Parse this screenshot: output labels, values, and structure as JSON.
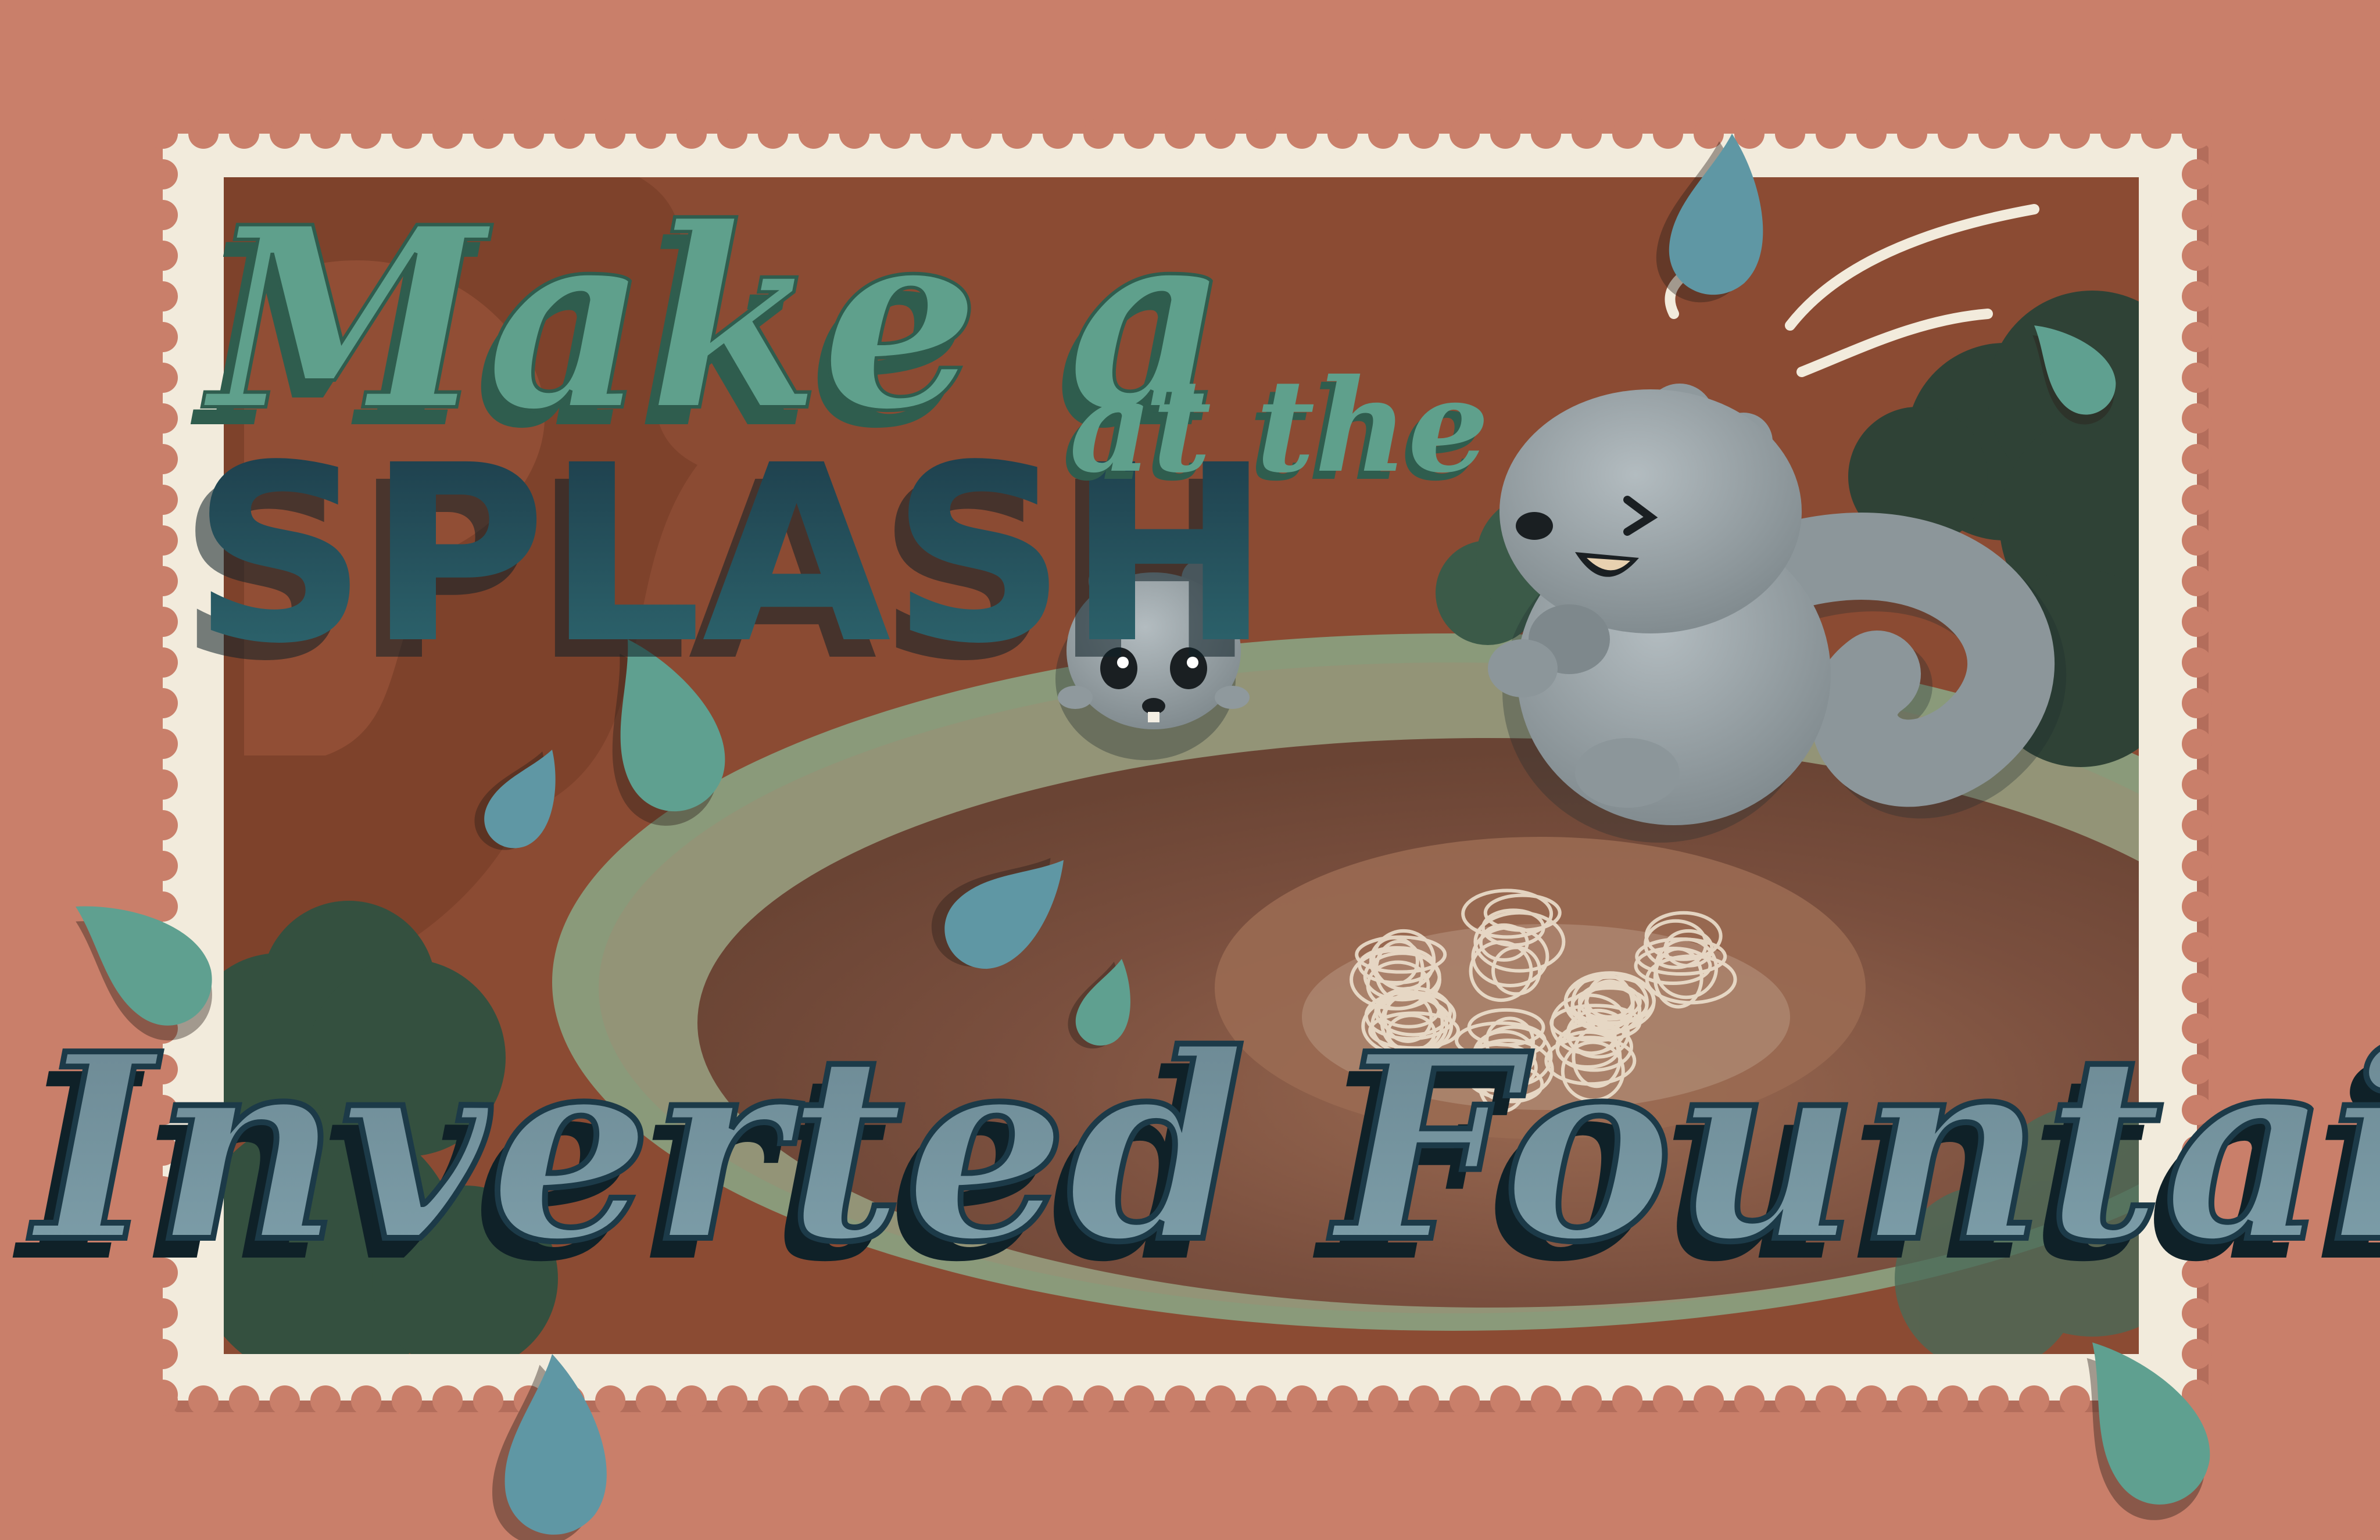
{
  "poster": {
    "headline_line1": "Make a",
    "headline_splash": "SPLASH",
    "headline_at_the": "at the",
    "headline_line3": "Inverted Fountain"
  },
  "colors": {
    "background": "#c97f6a",
    "stamp_border": "#f2ebdc",
    "scene_ground": "#8b4b33",
    "fountain_rim": "#8a9a7a",
    "fountain_basin": "#7a4f3e",
    "squirrel_gray": "#9aa3a7",
    "teal_text": "#5fa08c",
    "navy_text": "#1c3a48",
    "slate_text": "#6f8e9a",
    "water_drop_blue": "#5f97a4",
    "water_drop_teal": "#5fa090",
    "bush_dark": "#2f4236"
  },
  "icons": [
    "squirrel-large",
    "squirrel-small",
    "water-drop",
    "bush",
    "inverted-fountain",
    "postage-stamp-border"
  ]
}
